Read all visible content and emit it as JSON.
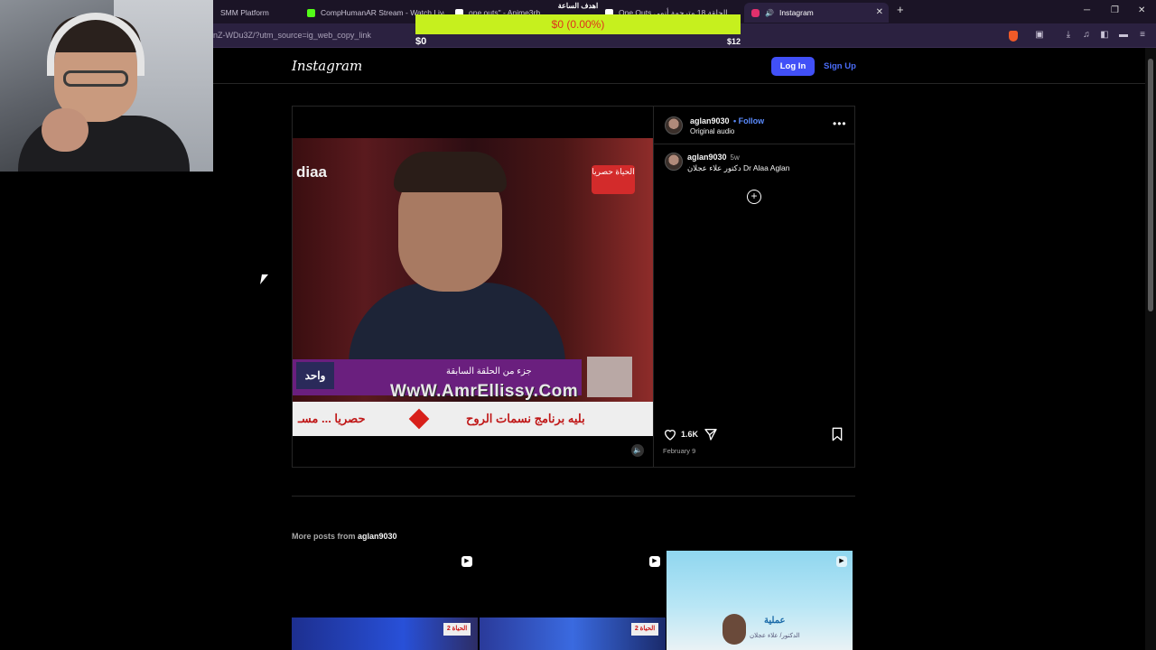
{
  "browser": {
    "tabs": [
      {
        "label": "SMM Platform",
        "favicon_color": "#1b1426"
      },
      {
        "label": "CompHumanAR Stream - Watch Live",
        "favicon_color": "#53fc18"
      },
      {
        "label": "one outs\" - Anime3rb",
        "favicon_color": "#ffffff"
      },
      {
        "label": "One Outs الحلقة 18 مترجمة أنمي",
        "favicon_color": "#ffffff"
      },
      {
        "label": "Instagram",
        "favicon_color": "#e1306c"
      }
    ],
    "url": "nZ-WDu3Z/?utm_source=ig_web_copy_link",
    "new_tab_symbol": "+",
    "close_symbol": "✕"
  },
  "goal": {
    "title": "اهدف الساعة",
    "progress_text": "$0 (0.00%)",
    "progress_fraction": 0.0,
    "min": "$0",
    "max": "$12"
  },
  "instagram": {
    "logo": "Instagram",
    "login_label": "Log In",
    "signup_label": "Sign Up",
    "post": {
      "username": "aglan9030",
      "follow_label": "• Follow",
      "audio": "Original audio",
      "caption_user": "aglan9030",
      "caption_age": "5w",
      "caption_text": "دكتور علاء عجلان Dr Alaa Aglan",
      "likes": "1.6K",
      "date": "February 9",
      "video": {
        "channel_left": "diaa",
        "channel_right": "الحياة حصريا",
        "lower_left": "واحد",
        "subtitle": "جزء من الحلقة السابقة",
        "watermark": "WwW.AmrEllissy.Com",
        "ticker_left": "حصريا ... مسـ",
        "ticker_right": "بليه برنامج نسمات الروح"
      }
    },
    "more_posts_prefix": "More posts from",
    "more_posts_user": "aglan9030",
    "thumbs": [
      {
        "tag": "الحياة 2"
      },
      {
        "tag": "الحياة 2"
      },
      {
        "title": "عملية",
        "subtitle": "الدكتور/ علاء عجلان"
      }
    ]
  }
}
